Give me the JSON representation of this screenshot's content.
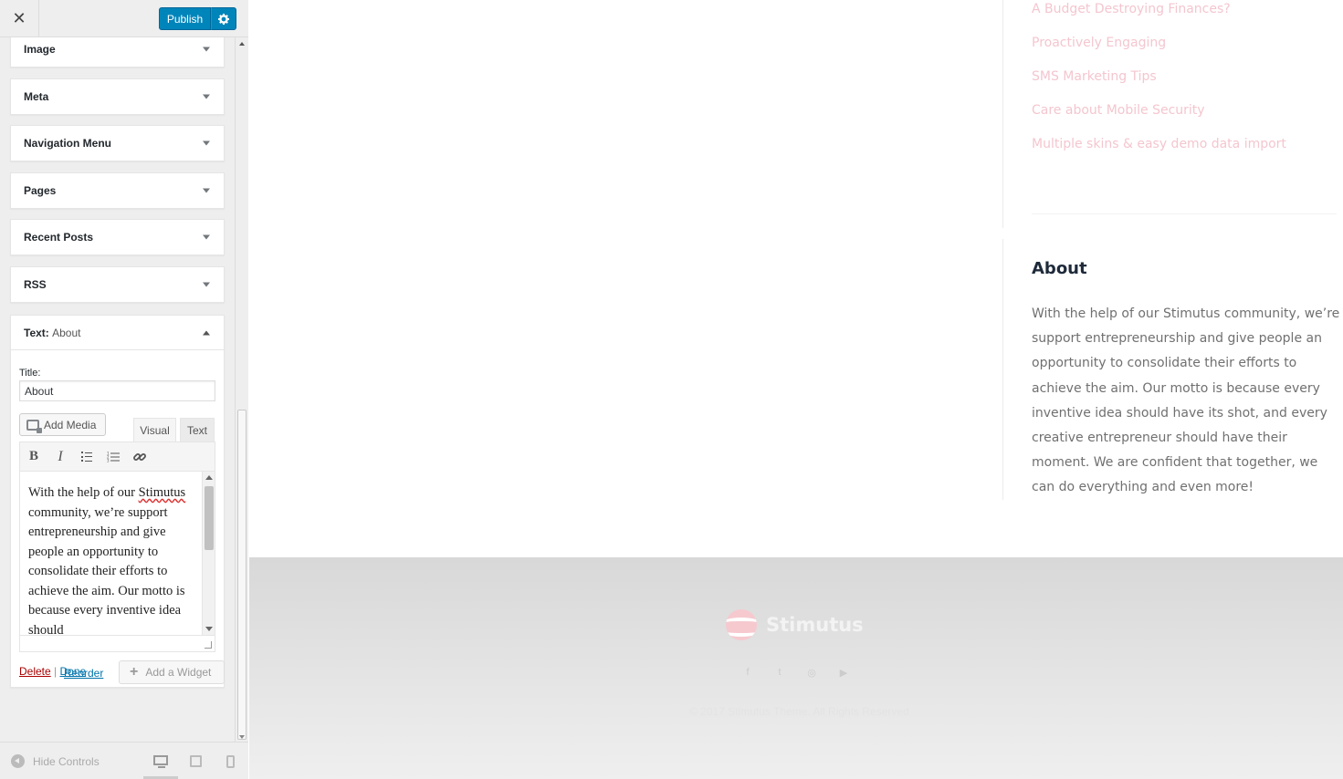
{
  "topbar": {
    "close_label": "✕",
    "publish_label": "Publish",
    "settings_icon": "gear-icon"
  },
  "widgets": [
    {
      "label": "Image"
    },
    {
      "label": "Meta"
    },
    {
      "label": "Navigation Menu"
    },
    {
      "label": "Pages"
    },
    {
      "label": "Recent Posts"
    },
    {
      "label": "RSS"
    }
  ],
  "text_widget": {
    "head_label": "Text:",
    "head_title": "About",
    "title_label": "Title:",
    "title_value": "About",
    "add_media_label": "Add Media",
    "tab_visual": "Visual",
    "tab_text": "Text",
    "toolbar": [
      "bold",
      "italic",
      "bulleted-list",
      "numbered-list",
      "link"
    ],
    "content_before": "With the help of our ",
    "content_misspelled": "Stimutus",
    "content_after": " community, we’re support entrepreneurship and give people an opportunity to consolidate their efforts to achieve the aim. Our motto is because every inventive idea should",
    "delete_label": "Delete",
    "separator": "|",
    "done_label": "Done"
  },
  "panel_actions": {
    "reorder_label": "Reorder",
    "add_widget_label": "Add a Widget"
  },
  "footer_controls": {
    "hide_label": "Hide Controls",
    "devices": [
      "desktop",
      "tablet",
      "mobile"
    ]
  },
  "preview": {
    "recent_posts": [
      "A Budget Destroying Finances?",
      "Proactively Engaging",
      "SMS Marketing Tips",
      "Care about Mobile Security",
      "Multiple skins & easy demo data import"
    ],
    "about_heading": "About",
    "about_body": "With the help of our Stimutus community, we’re support entrepreneurship and give people an opportunity to consolidate their efforts to achieve the aim. Our motto is because every inventive idea should have its shot, and every creative entrepreneur should have their moment. We are confident that together, we can do everything and even more!",
    "footer_logo_text": "Stimutus",
    "social": [
      "f",
      "t",
      "◎",
      "▶"
    ],
    "copyright": "© 2017 Stimutus Theme. All Rights Reserved"
  },
  "colors": {
    "publish_blue": "#0085ba",
    "link_pink": "#f4c6cf",
    "delete_red": "#a00"
  }
}
